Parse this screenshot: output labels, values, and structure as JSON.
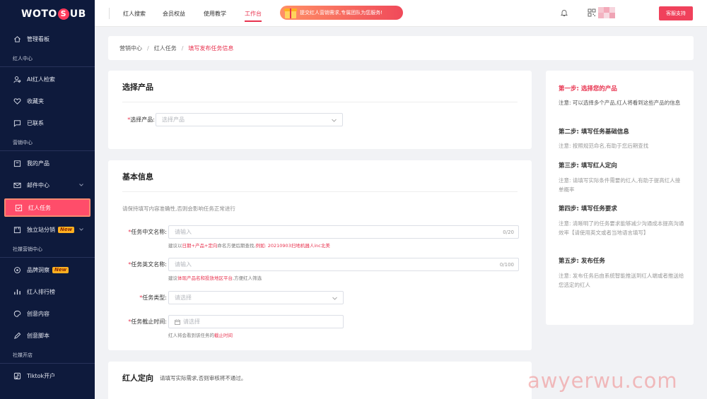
{
  "sidebar": {
    "logo": {
      "text_left": "WOTO",
      "text_mid": "S",
      "text_right": "UB"
    },
    "items": [
      {
        "label": "管理看板",
        "icon": "home-icon"
      },
      {
        "section": "红人中心"
      },
      {
        "label": "AI红人检索",
        "icon": "user-search-icon"
      },
      {
        "label": "收藏夹",
        "icon": "heart-icon"
      },
      {
        "label": "已联系",
        "icon": "chat-icon"
      },
      {
        "section": "营销中心"
      },
      {
        "label": "我的产品",
        "icon": "product-icon"
      },
      {
        "label": "邮件中心",
        "icon": "mail-icon"
      },
      {
        "label": "红人任务",
        "icon": "task-icon"
      },
      {
        "label": "独立站分销",
        "icon": "store-icon",
        "badge": "New"
      },
      {
        "section": "社媒营销中心"
      },
      {
        "label": "品牌洞察",
        "icon": "insight-icon",
        "badge": "New"
      },
      {
        "label": "红人排行榜",
        "icon": "ranking-icon"
      },
      {
        "label": "创意内容",
        "icon": "palette-icon"
      },
      {
        "label": "创意脚本",
        "icon": "pen-icon"
      },
      {
        "section": "社媒开店"
      },
      {
        "label": "Tiktok开户",
        "icon": "tiktok-icon"
      }
    ]
  },
  "topbar": {
    "tabs": [
      "红人搜索",
      "会员权益",
      "使用教学",
      "工作台"
    ],
    "promo": "提交红人营销需求,专属团队为您服务!",
    "support": "客服支持"
  },
  "breadcrumb": [
    "营销中心",
    "红人任务",
    "填写发布任务信息"
  ],
  "product_card": {
    "title": "选择产品",
    "label": "选择产品:",
    "placeholder": "选择产品"
  },
  "basic_card": {
    "title": "基本信息",
    "note": "请保持填写内容准确性,否则会影响任务正常进行",
    "cn_name": {
      "label": "任务中文名称:",
      "placeholder": "请输入",
      "count": "0/20",
      "hint_pre": "建议以",
      "hint_red1": "日期+产品+定向",
      "hint_mid": "命名方便后期查找,",
      "hint_red2": "例如: 20210903扫地机器人inc北美"
    },
    "en_name": {
      "label": "任务英文名称:",
      "placeholder": "请输入",
      "count": "0/100",
      "hint_pre": "建议",
      "hint_red": "体现产品名和投放地区平台",
      "hint_post": ",方便红人筛选"
    },
    "type": {
      "label": "任务类型:",
      "placeholder": "请选择"
    },
    "deadline": {
      "label": "任务截止时间:",
      "placeholder": "请选择",
      "hint_pre": "红人将会看到该任务的",
      "hint_red": "截止时间"
    }
  },
  "target_card": {
    "title": "红人定向",
    "note": "请填写实际需求,否则审核将不通过。"
  },
  "steps": [
    {
      "title": "第一步: 选择您的产品",
      "desc": "注意: 可以选择多个产品,红人将看到这些产品的信息"
    },
    {
      "title": "第二步: 填写任务基础信息",
      "desc": "注意: 按照规范命名,有助于您后期查找"
    },
    {
      "title": "第三步: 填写红人定向",
      "desc": "注意: 请填写实际条件需要的红人,有助于提高红人接单概率"
    },
    {
      "title": "第四步: 填写任务要求",
      "desc": "注意: 清晰明了的任务要求能够减少沟通成本提高沟通效率【请使用英文或者当地语言填写】"
    },
    {
      "title": "第五步: 发布任务",
      "desc": "注意: 发布任务后由系统智能推送到红人端或者推送给您选定的红人"
    }
  ],
  "watermark": "awyerwu.com",
  "colors": {
    "accent": "#e8334f",
    "sidebar": "#0e1a3c",
    "active_item": "#ff4d6a"
  }
}
